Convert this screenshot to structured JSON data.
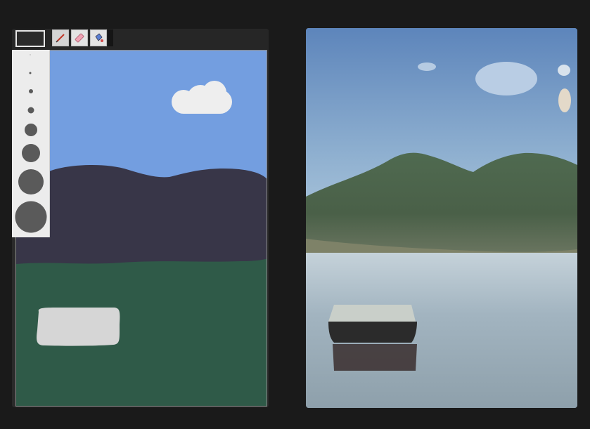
{
  "toolbar": {
    "current_color": "#2b2b2b",
    "tools": [
      {
        "name": "pencil-icon",
        "selected": true
      },
      {
        "name": "eraser-icon",
        "selected": false
      },
      {
        "name": "paint-bucket-icon",
        "selected": false
      }
    ]
  },
  "brush_sizes": {
    "count": 8,
    "selected_index": null,
    "color": "#5a5a5a"
  },
  "drawing_canvas": {
    "colors": {
      "sky": "#739ee0",
      "cloud": "#eeeeee",
      "mountain": "#383648",
      "ground": "#2f5a48",
      "boat": "#d6d6d6"
    }
  },
  "generated_image": {
    "colors": {
      "sky_top": "#5d85bb",
      "sky_bottom": "#b8cfdf",
      "mountain": "#45604a",
      "water": "#9aacb8",
      "boat": "#2a2a2a"
    }
  }
}
